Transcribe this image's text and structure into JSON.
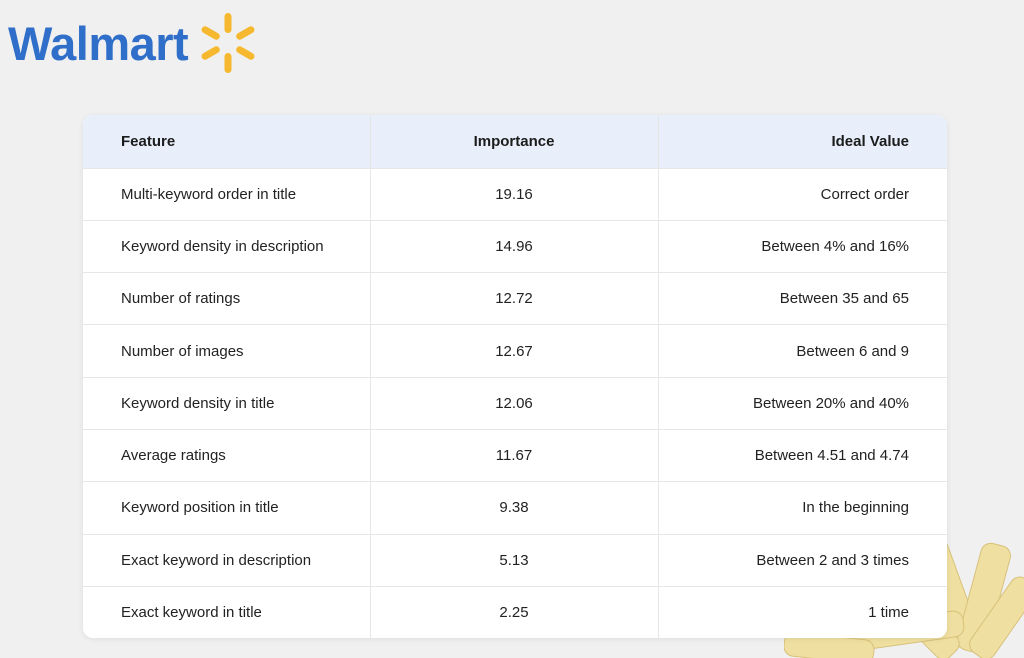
{
  "brand": {
    "name": "Walmart",
    "primary_color": "#2f6fc9",
    "spark_color": "#f5b82e",
    "spark_icon": "spark-icon"
  },
  "table": {
    "headers": [
      "Feature",
      "Importance",
      "Ideal Value"
    ],
    "rows": [
      [
        "Multi-keyword order in title",
        "19.16",
        "Correct order"
      ],
      [
        "Keyword density in description",
        "14.96",
        "Between 4% and 16%"
      ],
      [
        "Number of ratings",
        "12.72",
        "Between 35 and 65"
      ],
      [
        "Number of images",
        "12.67",
        "Between 6 and 9"
      ],
      [
        "Keyword density in title",
        "12.06",
        "Between 20% and 40%"
      ],
      [
        "Average ratings",
        "11.67",
        "Between 4.51 and 4.74"
      ],
      [
        "Keyword position in title",
        "9.38",
        "In the beginning"
      ],
      [
        "Exact keyword in description",
        "5.13",
        "Between 2 and 3 times"
      ],
      [
        "Exact keyword in title",
        "2.25",
        "1 time"
      ]
    ]
  },
  "decoration": {
    "pasta_icon": "pasta-image",
    "pasta_color": "#efdfa0"
  }
}
